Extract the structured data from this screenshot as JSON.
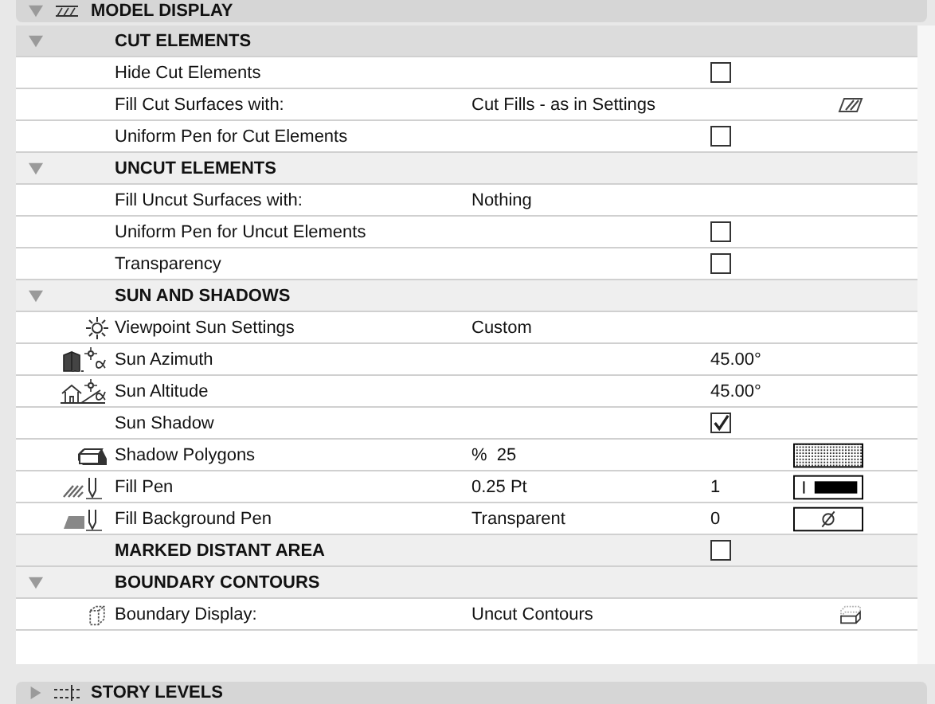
{
  "top_panel": {
    "title": "MODEL DISPLAY",
    "expanded": true
  },
  "sections": [
    {
      "title": "CUT ELEMENTS",
      "expanded": true,
      "selected": true,
      "rows": [
        {
          "label": "Hide Cut Elements",
          "checked": false
        },
        {
          "label": "Fill Cut Surfaces with:",
          "value": "Cut Fills - as in Settings"
        },
        {
          "label": "Uniform Pen for Cut Elements",
          "checked": false
        }
      ]
    },
    {
      "title": "UNCUT ELEMENTS",
      "expanded": true,
      "selected": false,
      "rows": [
        {
          "label": "Fill Uncut Surfaces with:",
          "value": "Nothing"
        },
        {
          "label": "Uniform Pen for Uncut Elements",
          "checked": false
        },
        {
          "label": "Transparency",
          "checked": false
        }
      ]
    },
    {
      "title": "SUN AND SHADOWS",
      "expanded": true,
      "selected": false,
      "rows": [
        {
          "label": "Viewpoint Sun Settings",
          "value": "Custom"
        },
        {
          "label": "Sun Azimuth",
          "reading": "45.00°"
        },
        {
          "label": "Sun Altitude",
          "reading": "45.00°"
        },
        {
          "label": "Sun Shadow",
          "checked": true
        },
        {
          "label": "Shadow Polygons",
          "value": "%  25"
        },
        {
          "label": "Fill Pen",
          "value": "0.25 Pt",
          "reading": "1"
        },
        {
          "label": "Fill Background Pen",
          "value": "Transparent",
          "reading": "0"
        }
      ]
    },
    {
      "title": "MARKED DISTANT AREA",
      "selected": false,
      "checked": false
    },
    {
      "title": "BOUNDARY CONTOURS",
      "expanded": true,
      "selected": false,
      "rows": [
        {
          "label": "Boundary Display:",
          "value": "Uncut Contours"
        }
      ]
    }
  ],
  "bottom_panel": {
    "title": "STORY LEVELS",
    "expanded": false
  }
}
